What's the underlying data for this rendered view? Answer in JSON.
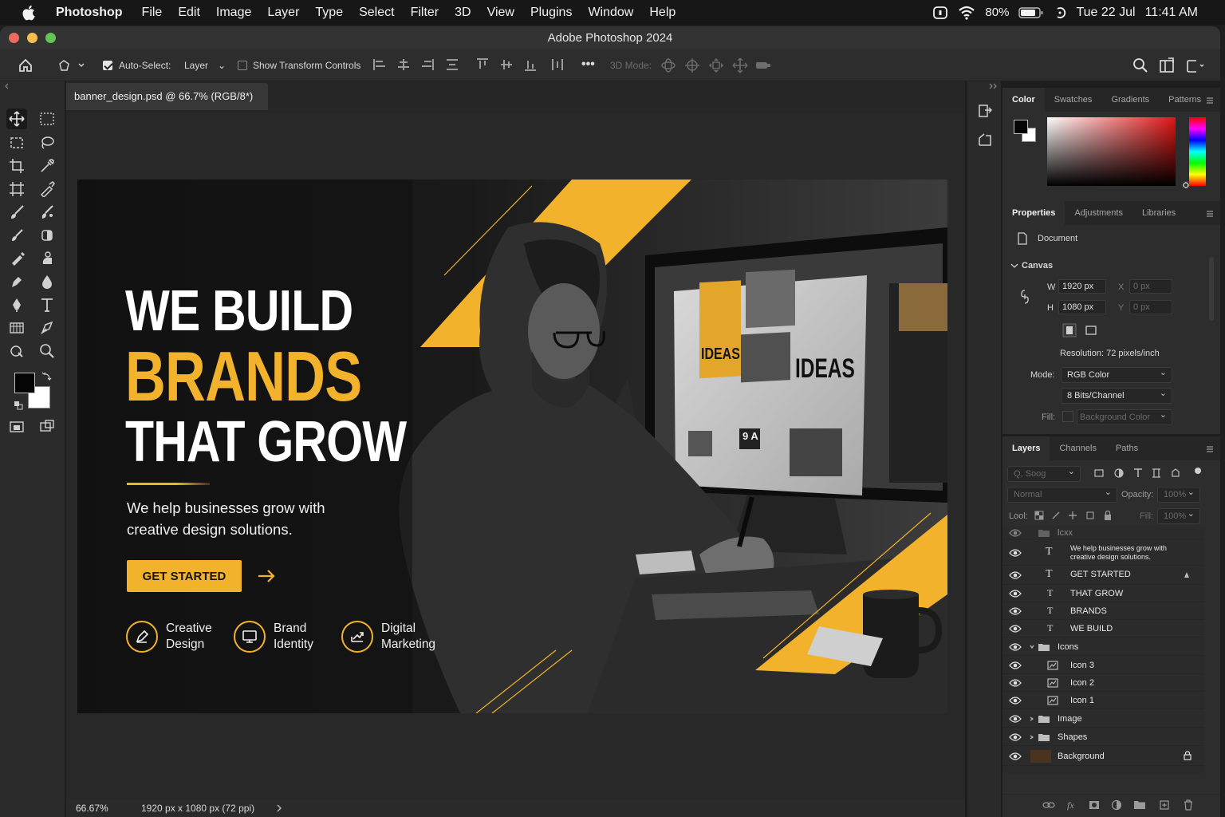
{
  "menubar": {
    "app_name": "Photoshop",
    "menus": [
      "File",
      "Edit",
      "Image",
      "Layer",
      "Type",
      "Select",
      "Filter",
      "3D",
      "View",
      "Plugins",
      "Window",
      "Help"
    ],
    "battery": "80%",
    "date": "Tue 22 Jul",
    "time": "11:41 AM"
  },
  "window": {
    "title": "Adobe Photoshop 2024"
  },
  "options_bar": {
    "auto_select_label": "Auto-Select:",
    "auto_select_target": "Layer",
    "show_transform_label": "Show Transform Controls",
    "more_label": "•••",
    "mode_3d_label": "3D Mode:"
  },
  "document": {
    "tab_title": "banner_design.psd @ 66.7% (RGB/8*)",
    "zoom": "66.67%",
    "doc_info": "1920 px x 1080 px (72 ppi)"
  },
  "banner": {
    "line1": "WE BUILD",
    "line2": "BRANDS",
    "line3": "THAT GROW",
    "subtext": "We help businesses grow with creative design solutions.",
    "cta": "GET STARTED",
    "features": [
      {
        "line1": "Creative",
        "line2": "Design",
        "icon": "pencil-edit-icon"
      },
      {
        "line1": "Brand",
        "line2": "Identity",
        "icon": "monitor-icon"
      },
      {
        "line1": "Digital",
        "line2": "Marketing",
        "icon": "trend-up-icon"
      }
    ],
    "screen_text_1": "IDEAS",
    "screen_text_2": "IDEAS",
    "screen_text_3": "9 A",
    "accent": "#f2b22b"
  },
  "color_panel": {
    "tabs": [
      "Color",
      "Swatches",
      "Gradients",
      "Patterns"
    ]
  },
  "properties_panel": {
    "tabs": [
      "Properties",
      "Adjustments",
      "Libraries"
    ],
    "doc_label": "Document",
    "canvas_label": "Canvas",
    "w_label": "W",
    "w_value": "1920 px",
    "h_label": "H",
    "h_value": "1080 px",
    "x_label": "X",
    "x_value": "0 px",
    "y_label": "Y",
    "y_value": "0 px",
    "resolution": "Resolution: 72 pixels/inch",
    "mode_label": "Mode:",
    "mode_value": "RGB Color",
    "bits_value": "8 Bits/Channel",
    "fill_label": "Fill:",
    "fill_value": "Background Color"
  },
  "layers_panel": {
    "tabs": [
      "Layers",
      "Channels",
      "Paths"
    ],
    "filter_placeholder": "Q, Soog",
    "blend_mode": "Normal",
    "opacity_label": "Opacity:",
    "opacity_value": "100%",
    "lock_label": "Lool:",
    "fill_label": "Fill:",
    "fill_value": "100%",
    "layers": [
      {
        "name": "lcxx",
        "kind": "group-faded"
      },
      {
        "name": "We help businesses grow with creative design solutions.",
        "kind": "text-multi"
      },
      {
        "name": "GET STARTED",
        "kind": "text"
      },
      {
        "name": "THAT GROW",
        "kind": "text"
      },
      {
        "name": "BRANDS",
        "kind": "text"
      },
      {
        "name": "WE BUILD",
        "kind": "text"
      },
      {
        "name": "Icons",
        "kind": "group"
      },
      {
        "name": "Icon 3",
        "kind": "smart"
      },
      {
        "name": "Icon 2",
        "kind": "smart"
      },
      {
        "name": "Icon 1",
        "kind": "smart"
      },
      {
        "name": "Image",
        "kind": "group"
      },
      {
        "name": "Shapes",
        "kind": "group"
      },
      {
        "name": "Background",
        "kind": "background"
      }
    ]
  }
}
